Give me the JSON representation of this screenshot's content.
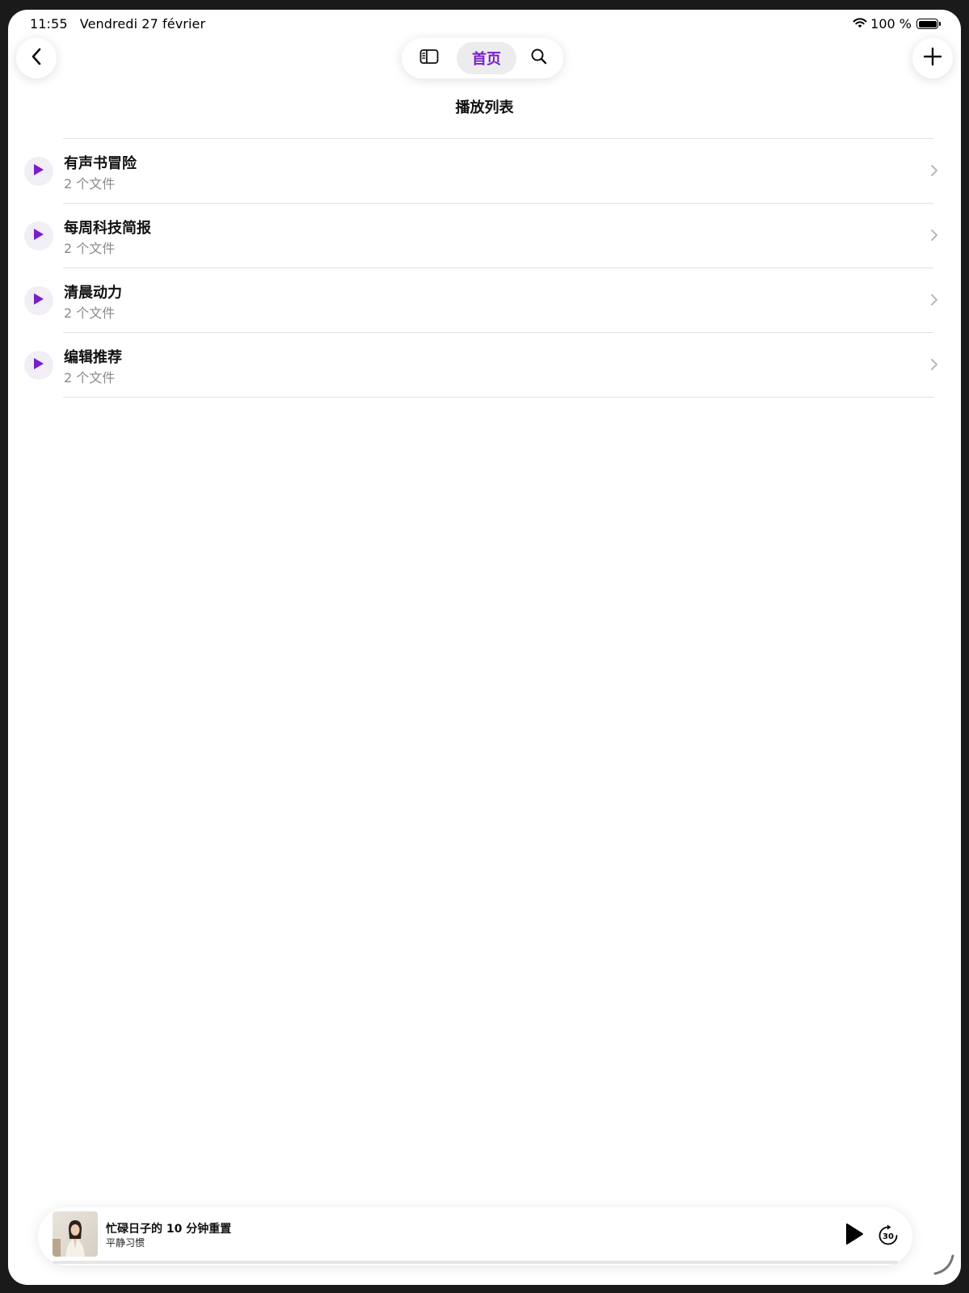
{
  "status_bar": {
    "time": "11:55",
    "date": "Vendredi 27 février",
    "battery_percent": "100 %",
    "icons": [
      "wifi-icon",
      "battery-icon"
    ]
  },
  "toolbar": {
    "back_icon": "chevron-left-icon",
    "add_icon": "plus-icon",
    "nav": {
      "sidebar_icon": "sidebar-icon",
      "home_label": "首页",
      "search_icon": "search-icon"
    }
  },
  "page": {
    "title": "播放列表"
  },
  "playlists": [
    {
      "title": "有声书冒险",
      "subtitle": "2 个文件"
    },
    {
      "title": "每周科技简报",
      "subtitle": "2 个文件"
    },
    {
      "title": "清晨动力",
      "subtitle": "2 个文件"
    },
    {
      "title": "编辑推荐",
      "subtitle": "2 个文件"
    }
  ],
  "mini_player": {
    "title": "忙碌日子的 10 分钟重置",
    "artist": "平静习惯",
    "skip_seconds": "30",
    "progress": 0.0
  },
  "colors": {
    "accent": "#7a1fc7",
    "secondary_text": "#8a8a8e",
    "divider": "#e2e2e2"
  }
}
